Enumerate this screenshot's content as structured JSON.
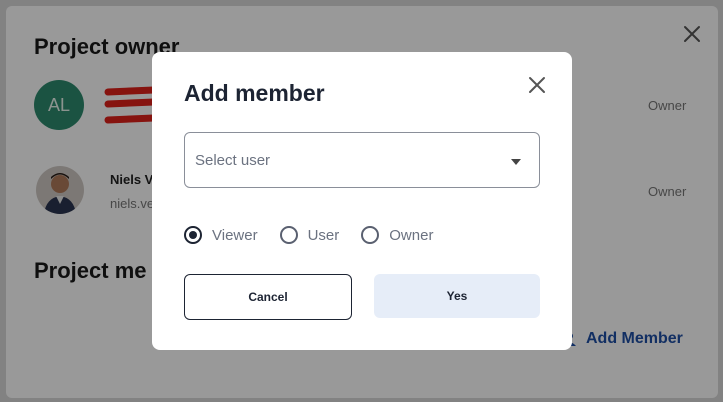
{
  "background": {
    "section_owner_title": "Project owner",
    "section_members_title": "Project me",
    "owner_avatar_initials": "AL",
    "owner_role": "Owner",
    "member": {
      "name": "Niels V",
      "email": "niels.ve",
      "role": "Owner"
    },
    "add_member_label": "Add Member"
  },
  "modal": {
    "title": "Add member",
    "select_placeholder": "Select user",
    "roles": [
      "Viewer",
      "User",
      "Owner"
    ],
    "selected_role": "Viewer",
    "cancel_label": "Cancel",
    "confirm_label": "Yes"
  },
  "icons": {
    "close": "close-icon",
    "caret": "chevron-down-icon",
    "add_member": "person-add-icon"
  },
  "colors": {
    "accent": "#1f4fa5",
    "avatar": "#2e8b6e",
    "confirm_bg": "#e6edf8"
  }
}
